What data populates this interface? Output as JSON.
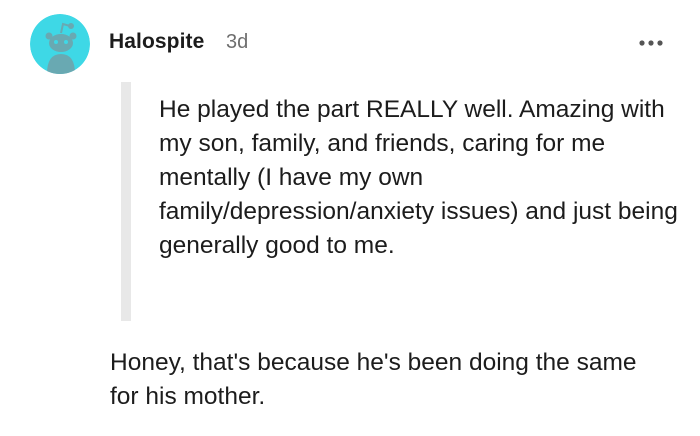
{
  "comment": {
    "author": "Halospite",
    "age": "3d",
    "avatar_icon": "snoo-avatar-icon",
    "more_icon": "more-options-icon",
    "quote": "He played the part REALLY well. Amazing with my son, family, and friends, caring for me mentally (I have my own family/depression/anxiety issues) and just being generally good to me.",
    "reply": "Honey, that's because he's been doing the same for his mother."
  },
  "colors": {
    "avatar_bg": "#3ed8e6",
    "avatar_figure": "#69a9b2",
    "quote_bar": "#e8e8e8",
    "text": "#1c1c1c",
    "muted": "#6e6e6e"
  }
}
